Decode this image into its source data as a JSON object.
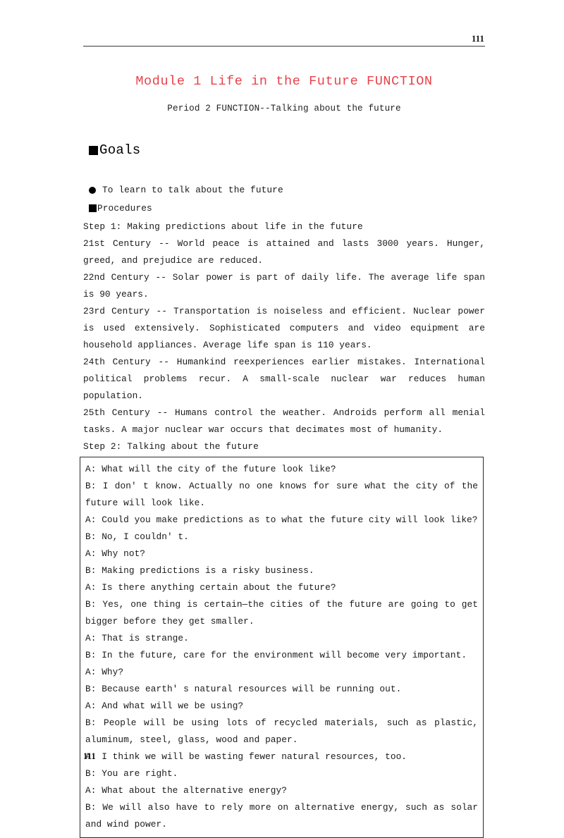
{
  "header": {
    "page_number": "111"
  },
  "title": {
    "main": "Module 1 Life in the Future FUNCTION",
    "subtitle": "Period 2 FUNCTION--Talking about the future",
    "main_color": "#e8424b"
  },
  "goals": {
    "heading": "Goals",
    "bullet_icon": "filled-square",
    "objective": "To learn to talk about the future",
    "objective_icon": "filled-circle",
    "procedures_heading": "Procedures",
    "procedures_icon": "filled-square"
  },
  "steps": {
    "step1": "Step 1: Making predictions about life in the future",
    "step2": "Step 2: Talking about the future"
  },
  "predictions": [
    "21st Century -- World peace is attained and lasts 3000 years. Hunger, greed, and prejudice are reduced.",
    "22nd Century -- Solar power is part of daily life. The average life span is 90 years.",
    "23rd Century -- Transportation is noiseless and efficient. Nuclear power is used extensively. Sophisticated computers and video equipment are household appliances. Average life span is 110 years.",
    "24th Century -- Humankind reexperiences earlier mistakes. International political problems recur. A small-scale nuclear war reduces human population.",
    "25th Century -- Humans control the weather. Androids perform all menial tasks. A major nuclear war occurs that decimates most of humanity."
  ],
  "dialogue": [
    "A: What will the city of the future look like?",
    "B: I don' t know. Actually no one knows for sure what the city of the future will look like.",
    "A: Could you make predictions as to what the future city will look like?",
    "B: No, I couldn' t.",
    "A: Why not?",
    "B: Making predictions is a risky business.",
    "A: Is there anything certain about the future?",
    "B: Yes, one thing is certain—the cities of the future are going to get bigger before they get smaller.",
    "A: That is strange.",
    "B: In the future, care for the environment will become very important.",
    "A: Why?",
    "B: Because earth' s natural resources will be running out.",
    "A: And what will we be using?",
    "B: People will be using lots of recycled materials, such as plastic, aluminum, steel, glass, wood and paper.",
    "A: I think we will be wasting fewer natural resources, too.",
    "B: You are right.",
    "A: What about the alternative energy?",
    "B: We will also have to rely more on alternative energy, such as solar and wind power."
  ],
  "footer": {
    "page_number": "111"
  }
}
